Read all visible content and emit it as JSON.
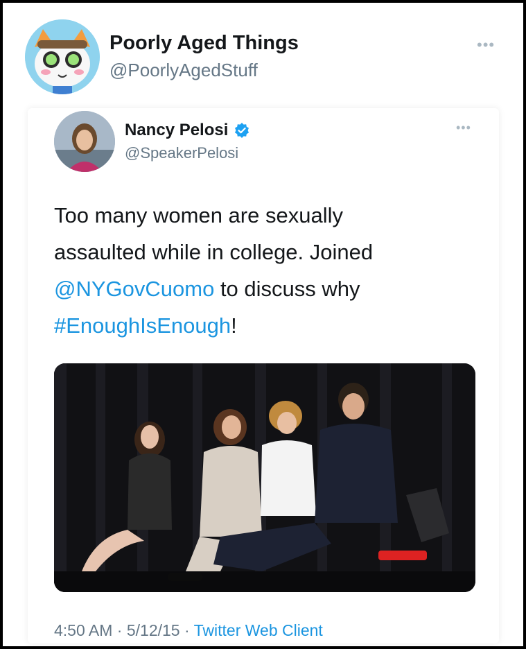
{
  "outer_tweet": {
    "display_name": "Poorly Aged Things",
    "handle": "@PoorlyAgedStuff",
    "more_icon": "more-options-icon",
    "more_glyph": "•••"
  },
  "quoted_tweet": {
    "display_name": "Nancy Pelosi",
    "handle": "@SpeakerPelosi",
    "verified": true,
    "more_glyph": "•••",
    "text": {
      "line1": "Too many women are sexually",
      "line2": "assaulted while in college. Joined",
      "mention": "@NYGovCuomo",
      "line3_rest": " to discuss why",
      "hashtag": "#EnoughIsEnough",
      "line4_rest": "!"
    },
    "time": "4:50 AM",
    "separator": " · ",
    "date": "5/12/15",
    "client": "Twitter Web Client"
  },
  "colors": {
    "link_blue": "#1b95e0",
    "verified_blue": "#1da1f2",
    "text_dark": "#14171a",
    "text_gray": "#657786"
  }
}
